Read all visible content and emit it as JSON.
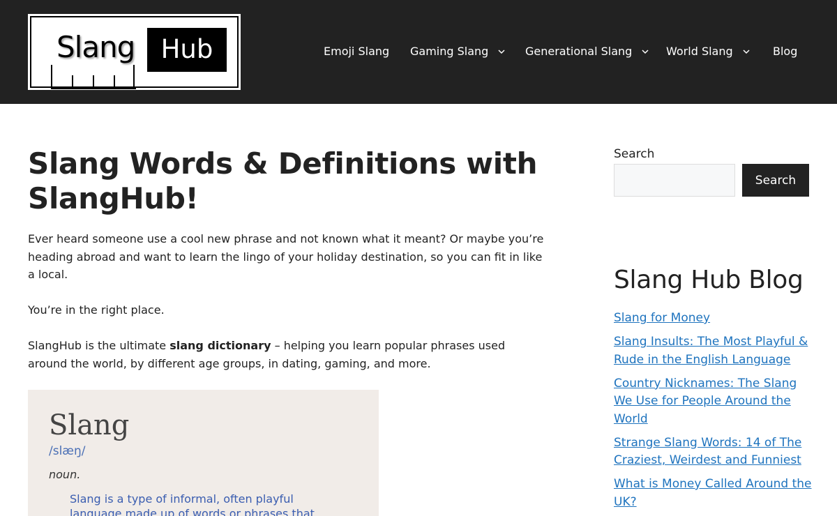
{
  "header": {
    "logo": {
      "word1": "Slang",
      "word2": "Hub"
    },
    "nav": [
      {
        "label": "Emoji Slang",
        "has_dropdown": false
      },
      {
        "label": "Gaming Slang",
        "has_dropdown": true
      },
      {
        "label": "Generational Slang",
        "has_dropdown": true
      },
      {
        "label": "World Slang",
        "has_dropdown": true
      },
      {
        "label": "Blog",
        "has_dropdown": false
      }
    ]
  },
  "main": {
    "title": "Slang Words & Definitions with SlangHub!",
    "para1": "Ever heard someone use a cool new phrase and not known what it meant? Or maybe you’re heading abroad and want to learn the lingo of your holiday destination, so you can fit in like a local.",
    "para2": "You’re in the right place.",
    "para3_before": "SlangHub is the ultimate ",
    "para3_bold": "slang dictionary",
    "para3_after": " – helping you learn popular phrases used around the world, by different age groups, in dating, gaming, and more.",
    "definition": {
      "word": "Slang",
      "phonetic": "/slæŋ/",
      "part_of_speech": "noun.",
      "text": "Slang is a type of informal, often playful language made up of words or phrases that"
    }
  },
  "sidebar": {
    "search_label": "Search",
    "search_value": "",
    "search_button": "Search",
    "blog_heading": "Slang Hub Blog",
    "blog_links": [
      "Slang for Money",
      "Slang Insults: The Most Playful & Rude in the English Language",
      "Country Nicknames: The Slang We Use for People Around the World",
      "Strange Slang Words: 14 of The Craziest, Weirdest and Funniest",
      "What is Money Called Around the UK?"
    ]
  },
  "colors": {
    "header_bg": "#222222",
    "link": "#1e73be",
    "definition_bg": "#f1ece8",
    "definition_accent": "#3a5db0"
  }
}
